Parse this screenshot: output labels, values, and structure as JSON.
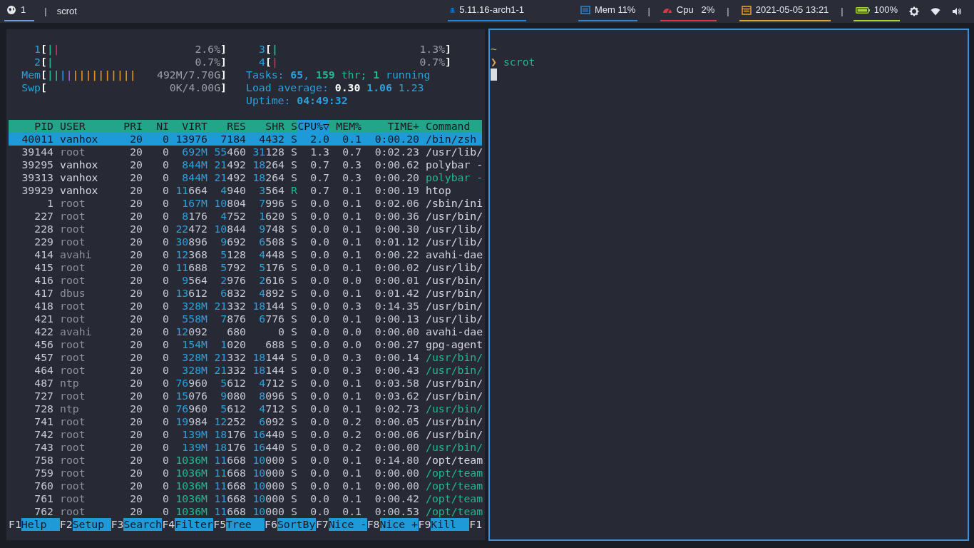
{
  "top_bar": {
    "left": [
      {
        "kind": "workspace",
        "label": "1",
        "color": "#6c9fd8"
      },
      {
        "kind": "separator",
        "label": "|"
      },
      {
        "kind": "title",
        "label": "scrot"
      }
    ],
    "center": [
      {
        "kind": "kernel",
        "label": "5.11.16-arch1-1",
        "color": "#1e88e5"
      }
    ],
    "right": [
      {
        "kind": "memory",
        "label": "Mem 11%",
        "color": "#2f86d6"
      },
      {
        "kind": "separator",
        "label": "|"
      },
      {
        "kind": "cpu",
        "label": "Cpu   2%",
        "color": "#e0344a"
      },
      {
        "kind": "separator",
        "label": "|"
      },
      {
        "kind": "date",
        "label": "2021-05-05 13:21",
        "color": "#e3a524"
      },
      {
        "kind": "separator",
        "label": "|"
      },
      {
        "kind": "battery",
        "label": "100%",
        "color": "#a6d62a"
      },
      {
        "kind": "settings"
      },
      {
        "kind": "wifi"
      },
      {
        "kind": "volume"
      }
    ]
  },
  "htop": {
    "focused": false,
    "meters_left": [
      {
        "label": "1",
        "open": "[",
        "close": "]",
        "value": "2.6%",
        "segments": [
          {
            "color": "#1fb890",
            "text": "|"
          },
          {
            "color": "#d6285f",
            "text": "|"
          }
        ]
      },
      {
        "label": "2",
        "open": "[",
        "close": "]",
        "value": "0.7%",
        "segments": [
          {
            "color": "#1fb890",
            "text": "|"
          }
        ]
      },
      {
        "label": "Mem",
        "open": "[",
        "close": "]",
        "value": "492M/7.70G",
        "segments": [
          {
            "color": "#1fb890",
            "text": "||"
          },
          {
            "color": "#2a8fd8",
            "text": "|"
          },
          {
            "color": "#8a5ae0",
            "text": "|"
          },
          {
            "color": "#e0901e",
            "text": "||||||||||"
          }
        ]
      },
      {
        "label": "Swp",
        "open": "[",
        "close": "]",
        "value": "0K/4.00G"
      }
    ],
    "meters_right": [
      {
        "label": "3",
        "open": "[",
        "close": "]",
        "value": "1.3%",
        "segments": [
          {
            "color": "#1fb890",
            "text": "|"
          }
        ]
      },
      {
        "label": "4",
        "open": "[",
        "close": "]",
        "value": "0.7%",
        "segments": [
          {
            "color": "#d6285f",
            "text": "|"
          }
        ]
      }
    ],
    "info_lines": [
      {
        "parts": [
          {
            "text": "Tasks: ",
            "kind": "label"
          },
          {
            "text": "65",
            "kind": "strong"
          },
          {
            "text": ", ",
            "kind": "label"
          },
          {
            "text": "159",
            "kind": "thread"
          },
          {
            "text": " thr; ",
            "kind": "thread_label"
          },
          {
            "text": "1",
            "kind": "thread"
          },
          {
            "text": " running",
            "kind": "label"
          }
        ]
      },
      {
        "parts": [
          {
            "text": "Load average: ",
            "kind": "label"
          },
          {
            "text": "0.30",
            "kind": "bright"
          },
          {
            "text": " 1.06",
            "kind": "strong"
          },
          {
            "text": " 1.23",
            "kind": "label"
          }
        ]
      },
      {
        "parts": [
          {
            "text": "Uptime: ",
            "kind": "label"
          },
          {
            "text": "04:49:32",
            "kind": "strong"
          }
        ]
      }
    ],
    "columns": [
      {
        "label": "PID",
        "sorted": false
      },
      {
        "label": "USER",
        "sorted": false
      },
      {
        "label": "PRI",
        "sorted": false
      },
      {
        "label": "NI",
        "sorted": false
      },
      {
        "label": "VIRT",
        "sorted": false
      },
      {
        "label": "RES",
        "sorted": false
      },
      {
        "label": "SHR",
        "sorted": false
      },
      {
        "label": "S",
        "sorted": false
      },
      {
        "label": "CPU%▽",
        "sorted": true
      },
      {
        "label": "MEM%",
        "sorted": false
      },
      {
        "label": "TIME+",
        "sorted": false
      },
      {
        "label": "Command",
        "sorted": false
      }
    ],
    "rows": [
      {
        "selected": true,
        "cells": [
          "40011",
          "vanhox",
          "20",
          "0",
          "13976",
          "7184",
          "4432",
          "S",
          "2.0",
          "0.1",
          "0:00.20",
          "/bin/zsh"
        ]
      },
      {
        "selected": false,
        "own": false,
        "running": false,
        "thread": false,
        "cells": [
          "39144",
          "root",
          "20",
          "0",
          "692M",
          "55460",
          "31128",
          "S",
          "1.3",
          "0.7",
          "0:02.23",
          "/usr/lib/"
        ]
      },
      {
        "selected": false,
        "own": true,
        "running": false,
        "thread": false,
        "cells": [
          "39295",
          "vanhox",
          "20",
          "0",
          "844M",
          "21492",
          "18264",
          "S",
          "0.7",
          "0.3",
          "0:00.62",
          "polybar -"
        ]
      },
      {
        "selected": false,
        "own": true,
        "running": false,
        "thread": true,
        "cells": [
          "39313",
          "vanhox",
          "20",
          "0",
          "844M",
          "21492",
          "18264",
          "S",
          "0.7",
          "0.3",
          "0:00.20",
          "polybar -"
        ]
      },
      {
        "selected": false,
        "own": true,
        "running": true,
        "thread": false,
        "cells": [
          "39929",
          "vanhox",
          "20",
          "0",
          "11664",
          "4940",
          "3564",
          "R",
          "0.7",
          "0.1",
          "0:00.19",
          "htop"
        ]
      },
      {
        "selected": false,
        "own": false,
        "running": false,
        "thread": false,
        "cells": [
          "1",
          "root",
          "20",
          "0",
          "167M",
          "10804",
          "7996",
          "S",
          "0.0",
          "0.1",
          "0:02.06",
          "/sbin/ini"
        ]
      },
      {
        "selected": false,
        "own": false,
        "running": false,
        "thread": false,
        "cells": [
          "227",
          "root",
          "20",
          "0",
          "8176",
          "4752",
          "1620",
          "S",
          "0.0",
          "0.1",
          "0:00.36",
          "/usr/bin/"
        ]
      },
      {
        "selected": false,
        "own": false,
        "running": false,
        "thread": false,
        "cells": [
          "228",
          "root",
          "20",
          "0",
          "22472",
          "10844",
          "9748",
          "S",
          "0.0",
          "0.1",
          "0:00.30",
          "/usr/lib/"
        ]
      },
      {
        "selected": false,
        "own": false,
        "running": false,
        "thread": false,
        "cells": [
          "229",
          "root",
          "20",
          "0",
          "30896",
          "9692",
          "6508",
          "S",
          "0.0",
          "0.1",
          "0:01.12",
          "/usr/lib/"
        ]
      },
      {
        "selected": false,
        "own": false,
        "running": false,
        "thread": false,
        "cells": [
          "414",
          "avahi",
          "20",
          "0",
          "12368",
          "5128",
          "4448",
          "S",
          "0.0",
          "0.1",
          "0:00.22",
          "avahi-dae"
        ]
      },
      {
        "selected": false,
        "own": false,
        "running": false,
        "thread": false,
        "cells": [
          "415",
          "root",
          "20",
          "0",
          "11688",
          "5792",
          "5176",
          "S",
          "0.0",
          "0.1",
          "0:00.02",
          "/usr/lib/"
        ]
      },
      {
        "selected": false,
        "own": false,
        "running": false,
        "thread": false,
        "cells": [
          "416",
          "root",
          "20",
          "0",
          "9564",
          "2976",
          "2616",
          "S",
          "0.0",
          "0.0",
          "0:00.01",
          "/usr/bin/"
        ]
      },
      {
        "selected": false,
        "own": false,
        "running": false,
        "thread": false,
        "cells": [
          "417",
          "dbus",
          "20",
          "0",
          "13612",
          "6832",
          "4892",
          "S",
          "0.0",
          "0.1",
          "0:01.42",
          "/usr/bin/"
        ]
      },
      {
        "selected": false,
        "own": false,
        "running": false,
        "thread": false,
        "cells": [
          "418",
          "root",
          "20",
          "0",
          "328M",
          "21332",
          "18144",
          "S",
          "0.0",
          "0.3",
          "0:14.35",
          "/usr/bin/"
        ]
      },
      {
        "selected": false,
        "own": false,
        "running": false,
        "thread": false,
        "cells": [
          "421",
          "root",
          "20",
          "0",
          "558M",
          "7876",
          "6776",
          "S",
          "0.0",
          "0.1",
          "0:00.13",
          "/usr/lib/"
        ]
      },
      {
        "selected": false,
        "own": false,
        "running": false,
        "thread": false,
        "cells": [
          "422",
          "avahi",
          "20",
          "0",
          "12092",
          "680",
          "0",
          "S",
          "0.0",
          "0.0",
          "0:00.00",
          "avahi-dae"
        ]
      },
      {
        "selected": false,
        "own": false,
        "running": false,
        "thread": false,
        "cells": [
          "456",
          "root",
          "20",
          "0",
          "154M",
          "1020",
          "688",
          "S",
          "0.0",
          "0.0",
          "0:00.27",
          "gpg-agent"
        ]
      },
      {
        "selected": false,
        "own": false,
        "running": false,
        "thread": true,
        "cells": [
          "457",
          "root",
          "20",
          "0",
          "328M",
          "21332",
          "18144",
          "S",
          "0.0",
          "0.3",
          "0:00.14",
          "/usr/bin/"
        ]
      },
      {
        "selected": false,
        "own": false,
        "running": false,
        "thread": true,
        "cells": [
          "464",
          "root",
          "20",
          "0",
          "328M",
          "21332",
          "18144",
          "S",
          "0.0",
          "0.3",
          "0:00.43",
          "/usr/bin/"
        ]
      },
      {
        "selected": false,
        "own": false,
        "running": false,
        "thread": false,
        "cells": [
          "487",
          "ntp",
          "20",
          "0",
          "76960",
          "5612",
          "4712",
          "S",
          "0.0",
          "0.1",
          "0:03.58",
          "/usr/bin/"
        ]
      },
      {
        "selected": false,
        "own": false,
        "running": false,
        "thread": false,
        "cells": [
          "727",
          "root",
          "20",
          "0",
          "15076",
          "9080",
          "8096",
          "S",
          "0.0",
          "0.1",
          "0:03.62",
          "/usr/bin/"
        ]
      },
      {
        "selected": false,
        "own": false,
        "running": false,
        "thread": true,
        "cells": [
          "728",
          "ntp",
          "20",
          "0",
          "76960",
          "5612",
          "4712",
          "S",
          "0.0",
          "0.1",
          "0:02.73",
          "/usr/bin/"
        ]
      },
      {
        "selected": false,
        "own": false,
        "running": false,
        "thread": false,
        "cells": [
          "741",
          "root",
          "20",
          "0",
          "19984",
          "12252",
          "6092",
          "S",
          "0.0",
          "0.2",
          "0:00.05",
          "/usr/bin/"
        ]
      },
      {
        "selected": false,
        "own": false,
        "running": false,
        "thread": false,
        "cells": [
          "742",
          "root",
          "20",
          "0",
          "139M",
          "18176",
          "16440",
          "S",
          "0.0",
          "0.2",
          "0:00.06",
          "/usr/bin/"
        ]
      },
      {
        "selected": false,
        "own": false,
        "running": false,
        "thread": true,
        "cells": [
          "743",
          "root",
          "20",
          "0",
          "139M",
          "18176",
          "16440",
          "S",
          "0.0",
          "0.2",
          "0:00.00",
          "/usr/bin/"
        ]
      },
      {
        "selected": false,
        "own": false,
        "running": false,
        "thread": false,
        "cells": [
          "758",
          "root",
          "20",
          "0",
          "1036M",
          "11668",
          "10000",
          "S",
          "0.0",
          "0.1",
          "0:14.80",
          "/opt/team"
        ]
      },
      {
        "selected": false,
        "own": false,
        "running": false,
        "thread": true,
        "cells": [
          "759",
          "root",
          "20",
          "0",
          "1036M",
          "11668",
          "10000",
          "S",
          "0.0",
          "0.1",
          "0:00.00",
          "/opt/team"
        ]
      },
      {
        "selected": false,
        "own": false,
        "running": false,
        "thread": true,
        "cells": [
          "760",
          "root",
          "20",
          "0",
          "1036M",
          "11668",
          "10000",
          "S",
          "0.0",
          "0.1",
          "0:00.00",
          "/opt/team"
        ]
      },
      {
        "selected": false,
        "own": false,
        "running": false,
        "thread": true,
        "cells": [
          "761",
          "root",
          "20",
          "0",
          "1036M",
          "11668",
          "10000",
          "S",
          "0.0",
          "0.1",
          "0:00.42",
          "/opt/team"
        ]
      },
      {
        "selected": false,
        "own": false,
        "running": false,
        "thread": true,
        "cells": [
          "762",
          "root",
          "20",
          "0",
          "1036M",
          "11668",
          "10000",
          "S",
          "0.0",
          "0.1",
          "0:00.53",
          "/opt/team"
        ]
      }
    ],
    "function_keys": [
      {
        "key": "F1",
        "label": "Help"
      },
      {
        "key": "F2",
        "label": "Setup"
      },
      {
        "key": "F3",
        "label": "Search"
      },
      {
        "key": "F4",
        "label": "Filter"
      },
      {
        "key": "F5",
        "label": "Tree"
      },
      {
        "key": "F6",
        "label": "SortBy"
      },
      {
        "key": "F7",
        "label": "Nice -"
      },
      {
        "key": "F8",
        "label": "Nice +"
      },
      {
        "key": "F9",
        "label": "Kill"
      },
      {
        "key": "F1"
      }
    ]
  },
  "terminal": {
    "focused": true,
    "lines": [
      {
        "kind": "cwd",
        "text": "~"
      },
      {
        "kind": "prompt",
        "symbol": "❯",
        "command": "scrot"
      },
      {
        "kind": "cursor"
      }
    ]
  }
}
